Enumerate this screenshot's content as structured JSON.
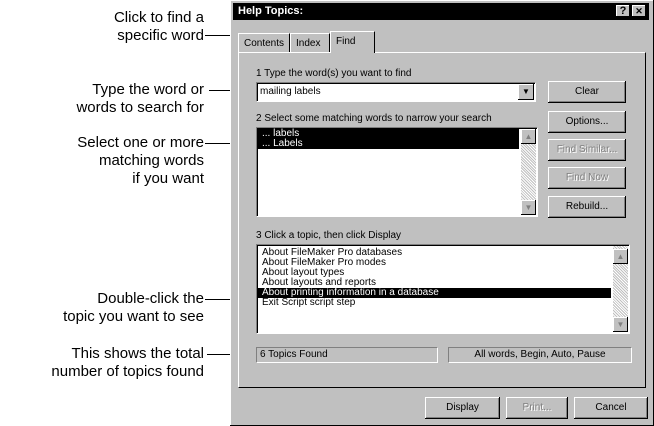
{
  "callouts": [
    {
      "lines": [
        "Click to find a",
        "specific word"
      ]
    },
    {
      "lines": [
        "Type the word or",
        "words to search for"
      ]
    },
    {
      "lines": [
        "Select one or more",
        "matching words",
        "if you want"
      ]
    },
    {
      "lines": [
        "Double-click the",
        "topic you want to see"
      ]
    },
    {
      "lines": [
        "This shows the total",
        "number of topics found"
      ]
    }
  ],
  "window": {
    "title": "Help Topics:",
    "help_button": "?",
    "close_button": "✕"
  },
  "tabs": [
    "Contents",
    "Index",
    "Find"
  ],
  "find": {
    "step1_label": "1 Type the word(s) you want to find",
    "search_value": "mailing labels",
    "step2_label": "2 Select some matching words to narrow your search",
    "matching_words": [
      "... labels",
      "... Labels"
    ],
    "step3_label": "3 Click a topic, then click Display",
    "topics": [
      "About FileMaker Pro databases",
      "About FileMaker Pro modes",
      "About layout types",
      "About layouts and reports",
      "About printing information in a database",
      "Exit Script script step"
    ],
    "selected_topic": "About printing information in a database",
    "status_count": "6 Topics Found",
    "status_options": "All words, Begin, Auto, Pause"
  },
  "side_buttons": {
    "clear": "Clear",
    "options": "Options...",
    "find_similar": "Find Similar...",
    "find_now": "Find Now",
    "rebuild": "Rebuild..."
  },
  "bottom_buttons": {
    "display": "Display",
    "print": "Print...",
    "cancel": "Cancel"
  },
  "icons": {
    "dropdown": "chevron-down-icon",
    "scroll_up": "triangle-up-icon",
    "scroll_down": "triangle-down-icon"
  }
}
